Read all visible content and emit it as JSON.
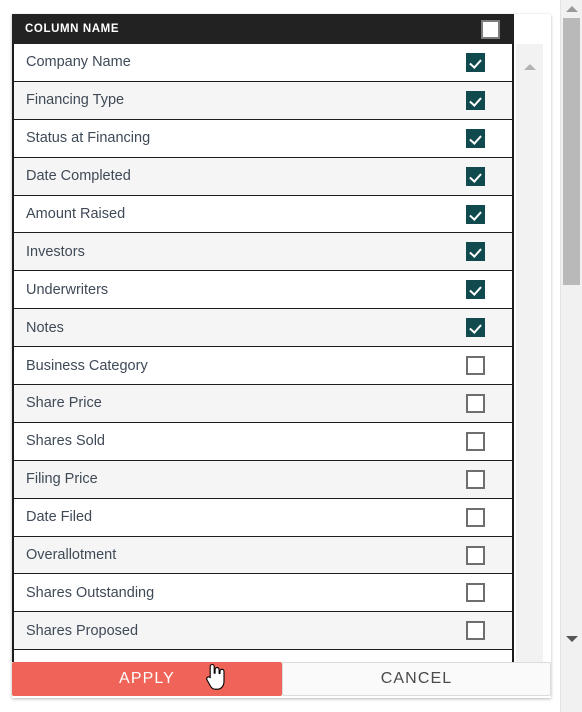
{
  "dialog": {
    "header": {
      "title": "COLUMN NAME",
      "select_all_checked": false,
      "select_all_icon": "checkbox-empty-icon"
    },
    "columns": [
      {
        "label": "Company Name",
        "checked": true
      },
      {
        "label": "Financing Type",
        "checked": true
      },
      {
        "label": "Status at Financing",
        "checked": true
      },
      {
        "label": "Date Completed",
        "checked": true
      },
      {
        "label": "Amount Raised",
        "checked": true
      },
      {
        "label": "Investors",
        "checked": true
      },
      {
        "label": "Underwriters",
        "checked": true
      },
      {
        "label": "Notes",
        "checked": true
      },
      {
        "label": "Business Category",
        "checked": false
      },
      {
        "label": "Share Price",
        "checked": false
      },
      {
        "label": "Shares Sold",
        "checked": false
      },
      {
        "label": "Filing Price",
        "checked": false
      },
      {
        "label": "Date Filed",
        "checked": false
      },
      {
        "label": "Overallotment",
        "checked": false
      },
      {
        "label": "Shares Outstanding",
        "checked": false
      },
      {
        "label": "Shares Proposed",
        "checked": false
      }
    ],
    "footer": {
      "apply_label": "APPLY",
      "cancel_label": "CANCEL"
    }
  },
  "scrollbars": {
    "inner": {
      "up_arrow_icon": "triangle-up-icon"
    },
    "outer": {
      "up_arrow_icon": "triangle-up-icon",
      "down_arrow_icon": "triangle-down-icon"
    }
  },
  "cursor": {
    "icon": "pointing-hand-cursor"
  },
  "colors": {
    "header_bg": "#222222",
    "checked_checkbox": "#114a4e",
    "apply_button": "#ef6358",
    "row_alt_bg": "#f5f5f5",
    "row_text": "#3f4a57"
  }
}
